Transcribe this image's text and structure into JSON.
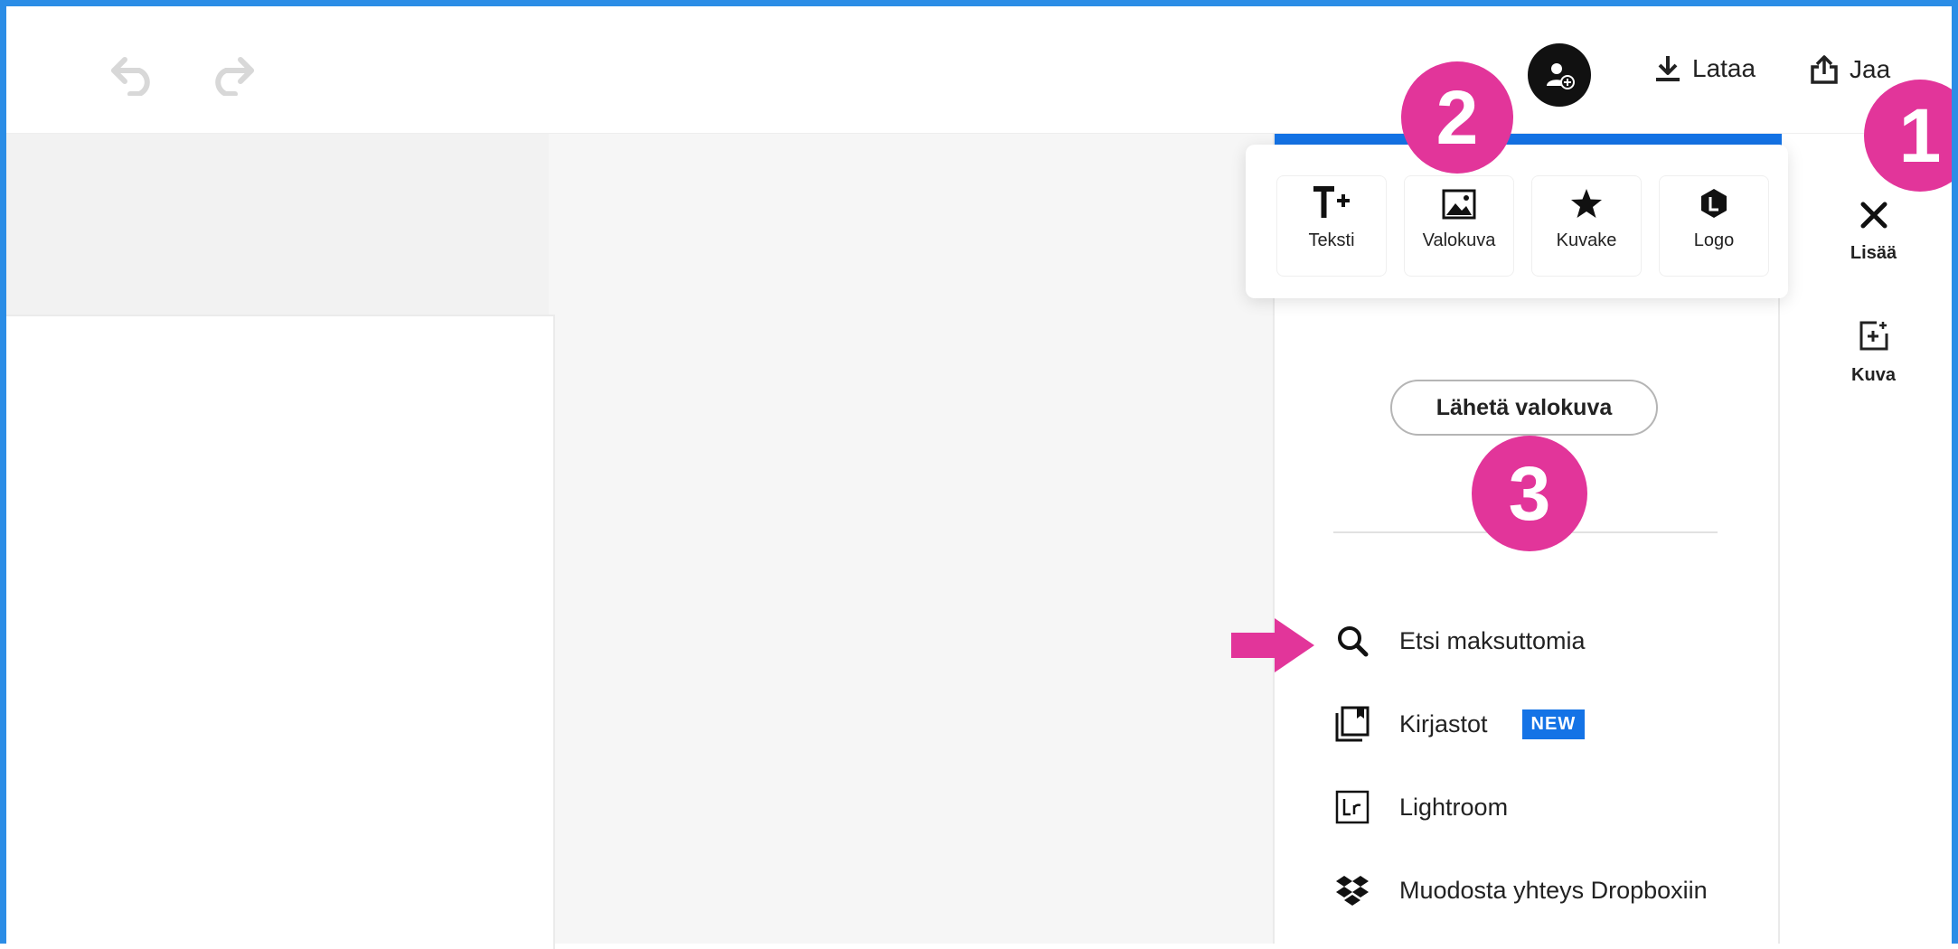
{
  "toolbar": {
    "undo_icon": "undo-icon",
    "redo_icon": "redo-icon",
    "avatar_icon": "add-user-icon",
    "download_label": "Lataa",
    "share_label": "Jaa"
  },
  "rail": {
    "close_label": "Lisää",
    "image_label": "Kuva"
  },
  "popover": {
    "tiles": [
      {
        "label": "Teksti",
        "icon": "text-plus-icon"
      },
      {
        "label": "Valokuva",
        "icon": "photo-icon"
      },
      {
        "label": "Kuvake",
        "icon": "star-icon"
      },
      {
        "label": "Logo",
        "icon": "logo-icon"
      }
    ]
  },
  "panel": {
    "upload_label": "Lähetä valokuva",
    "items": [
      {
        "label": "Etsi maksuttomia",
        "icon": "search-icon"
      },
      {
        "label": "Kirjastot",
        "icon": "library-icon",
        "badge": "NEW"
      },
      {
        "label": "Lightroom",
        "icon": "lightroom-icon"
      },
      {
        "label": "Muodosta yhteys Dropboxiin",
        "icon": "dropbox-icon"
      }
    ]
  },
  "annotations": {
    "marker_1": "1",
    "marker_2": "2",
    "marker_3": "3"
  },
  "colors": {
    "accent_blue": "#1473e6",
    "frame_blue": "#2b8de6",
    "marker_pink": "#e2359a"
  }
}
